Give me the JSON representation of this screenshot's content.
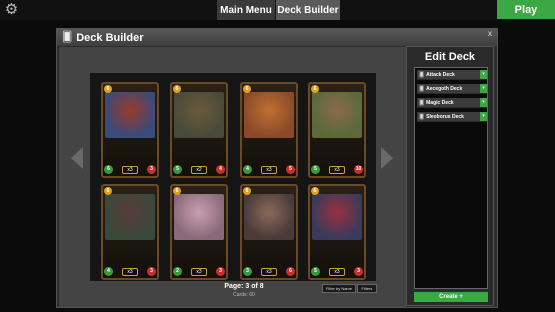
{
  "topbar": {
    "main_menu": "Main Menu",
    "deck_builder": "Deck Builder",
    "play": "Play"
  },
  "window": {
    "title": "Deck Builder",
    "close": "x"
  },
  "pagination": {
    "page_label": "Page: 3 of 8",
    "cards_label": "Cards: 60"
  },
  "filters": {
    "filter_by_name": "Filter by Name",
    "filters": "Filters"
  },
  "edit_deck": {
    "title": "Edit Deck",
    "decks": [
      {
        "label": "Attack Deck"
      },
      {
        "label": "Aecegoth Deck"
      },
      {
        "label": "Magic Deck"
      },
      {
        "label": "Sleoborus Deck"
      }
    ],
    "create_label": "Create +"
  },
  "colors": {
    "accent_green": "#3ca843",
    "card_frame": "#6b4a23"
  },
  "cards": [
    {
      "cost": "6",
      "attack": "6",
      "health": "3",
      "qty": "x3",
      "art": [
        "#3a4a7a",
        "#9a3a2a"
      ]
    },
    {
      "cost": "6",
      "attack": "5",
      "health": "4",
      "qty": "x2",
      "art": [
        "#4a4a3a",
        "#6a5a3a"
      ]
    },
    {
      "cost": "6",
      "attack": "4",
      "health": "5",
      "qty": "x3",
      "art": [
        "#8a4a2a",
        "#c07030"
      ]
    },
    {
      "cost": "6",
      "attack": "5",
      "health": "10",
      "qty": "x3",
      "art": [
        "#5a6a3a",
        "#8a6a4a"
      ]
    },
    {
      "cost": "6",
      "attack": "4",
      "health": "3",
      "qty": "x3",
      "art": [
        "#3a4a3a",
        "#5a3a3a"
      ]
    },
    {
      "cost": "6",
      "attack": "2",
      "health": "3",
      "qty": "x3",
      "art": [
        "#8a6a7a",
        "#c8a0b0"
      ]
    },
    {
      "cost": "6",
      "attack": "3",
      "health": "6",
      "qty": "x3",
      "art": [
        "#4a3a3a",
        "#8a6a5a"
      ]
    },
    {
      "cost": "6",
      "attack": "5",
      "health": "3",
      "qty": "x3",
      "art": [
        "#3a3a5a",
        "#9a3040"
      ]
    }
  ]
}
